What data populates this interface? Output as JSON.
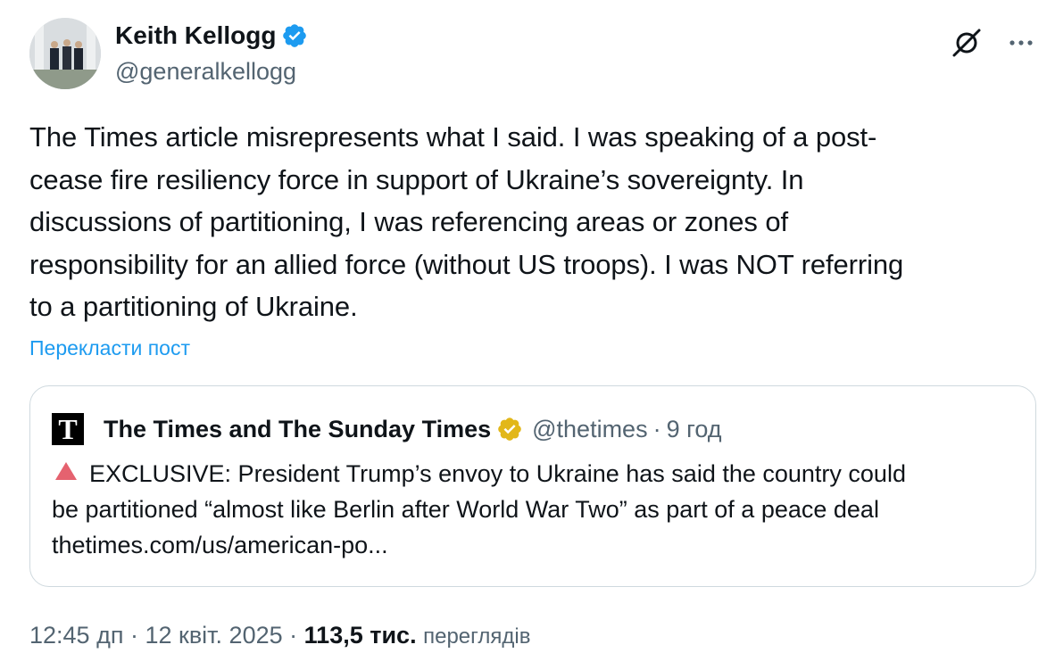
{
  "author": {
    "name": "Keith Kellogg",
    "handle": "@generalkellogg",
    "verified_color": "#1d9bf0"
  },
  "icons": {
    "verified": "verified-badge-icon",
    "grok": "grok-icon",
    "more": "more-options-icon",
    "quote_verified": "gold-verified-badge-icon",
    "alert": "red-triangle-icon"
  },
  "tweet": {
    "lines": [
      "The Times article misrepresents what I said. I was speaking of a post-",
      "cease fire resiliency force in support of Ukraine’s sovereignty. In",
      "discussions of partitioning, I was referencing areas or zones of",
      "responsibility for an allied force (without US troops). I was NOT referring",
      "to a partitioning of Ukraine."
    ],
    "translate_label": "Перекласти пост"
  },
  "quote": {
    "avatar_letter": "T",
    "name": "The Times and The Sunday Times",
    "handle": "@thetimes",
    "separator": "·",
    "time": "9 год",
    "badge_color": "#e2b719",
    "lines": [
      "EXCLUSIVE: President Trump’s envoy to Ukraine has said the country could",
      "be partitioned “almost like Berlin after World War Two” as part of a peace deal",
      "thetimes.com/us/american-po..."
    ]
  },
  "footer": {
    "time": "12:45 дп",
    "separator1": "·",
    "date": "12 квіт. 2025",
    "separator2": "·",
    "views_count": "113,5 тис.",
    "views_label": "переглядів"
  },
  "colors": {
    "accent": "#1d9bf0",
    "text_primary": "#0f1419",
    "text_secondary": "#536471",
    "border": "#cfd9de",
    "alert_red": "#e5626f"
  }
}
